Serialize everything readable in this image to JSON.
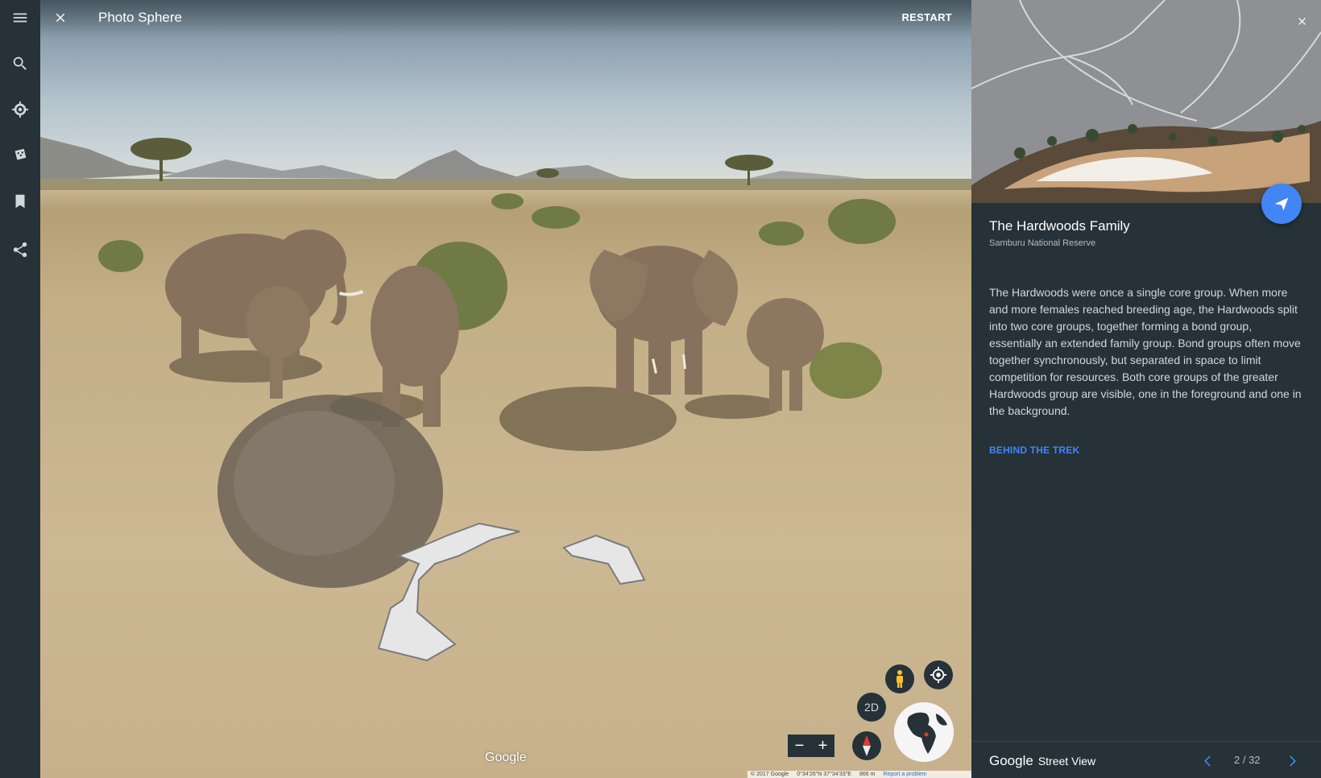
{
  "rail": {
    "items": [
      {
        "name": "menu-icon"
      },
      {
        "name": "search-icon"
      },
      {
        "name": "explore-wheel-icon"
      },
      {
        "name": "random-dice-icon"
      },
      {
        "name": "bookmark-icon"
      },
      {
        "name": "share-icon"
      }
    ]
  },
  "viewer": {
    "title": "Photo Sphere",
    "restart_label": "RESTART",
    "btn_2d": "2D",
    "zoom_out": "−",
    "zoom_in": "+",
    "watermark": "Google",
    "footer": {
      "copyright": "© 2017 Google",
      "coords": "0°34'26\"N 37°34'33\"E",
      "scale": "866 m",
      "report": "Report a problem"
    }
  },
  "panel": {
    "title": "The Hardwoods Family",
    "subtitle": "Samburu National Reserve",
    "body": "The Hardwoods were once a single core group. When more and more females reached breeding age, the Hardwoods split into two core groups, together forming a bond group, essentially an extended family group. Bond groups often move together synchronously, but separated in space to limit competition for resources. Both core groups of the greater Hardwoods group are visible, one in the foreground and one in the background.",
    "link": "BEHIND THE TREK",
    "brand_google": "Google",
    "brand_product": "Street View",
    "counter": "2 / 32"
  },
  "colors": {
    "accent": "#4285f4",
    "panel_bg": "#263238"
  }
}
